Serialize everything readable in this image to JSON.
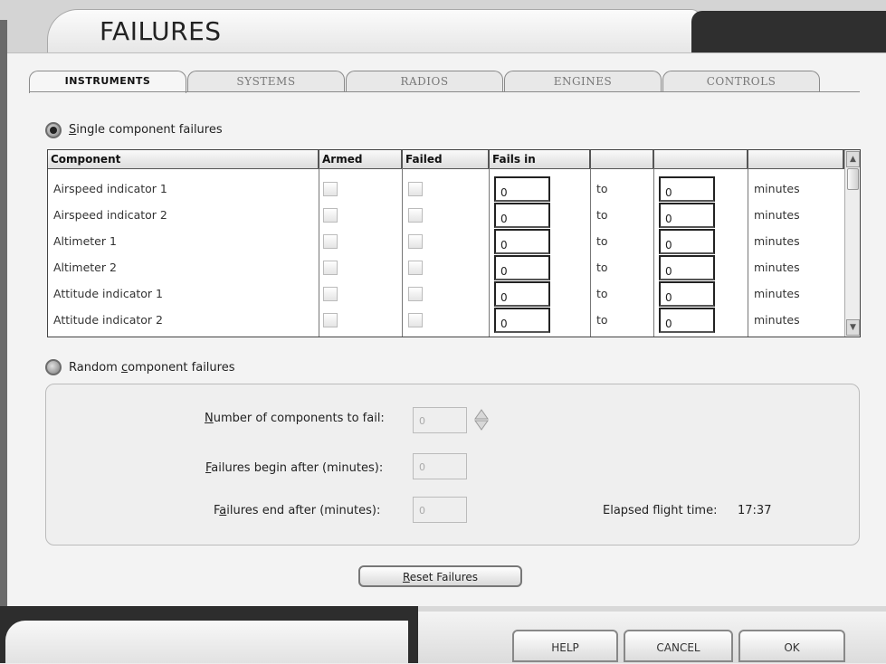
{
  "window": {
    "title": "FAILURES"
  },
  "tabs": [
    {
      "label": "INSTRUMENTS",
      "active": true
    },
    {
      "label": "SYSTEMS",
      "active": false
    },
    {
      "label": "RADIOS",
      "active": false
    },
    {
      "label": "ENGINES",
      "active": false
    },
    {
      "label": "CONTROLS",
      "active": false
    }
  ],
  "single": {
    "label_hot": "S",
    "label_rest": "ingle component failures",
    "selected": true
  },
  "table": {
    "headers": [
      "Component",
      "Armed",
      "Failed",
      "Fails in",
      "",
      "",
      ""
    ],
    "rows": [
      {
        "component": "Airspeed indicator 1",
        "from": "0",
        "to_label": "to",
        "to": "0",
        "unit": "minutes"
      },
      {
        "component": "Airspeed indicator 2",
        "from": "0",
        "to_label": "to",
        "to": "0",
        "unit": "minutes"
      },
      {
        "component": "Altimeter 1",
        "from": "0",
        "to_label": "to",
        "to": "0",
        "unit": "minutes"
      },
      {
        "component": "Altimeter 2",
        "from": "0",
        "to_label": "to",
        "to": "0",
        "unit": "minutes"
      },
      {
        "component": "Attitude indicator 1",
        "from": "0",
        "to_label": "to",
        "to": "0",
        "unit": "minutes"
      },
      {
        "component": "Attitude indicator 2",
        "from": "0",
        "to_label": "to",
        "to": "0",
        "unit": "minutes"
      }
    ]
  },
  "random": {
    "label_pre": "Random ",
    "label_hot": "c",
    "label_rest": "omponent failures",
    "selected": false,
    "num_components": {
      "hot": "N",
      "rest": "umber of components to fail:",
      "value": "0"
    },
    "begin_after": {
      "hot": "F",
      "rest": "ailures begin after (minutes):",
      "value": "0"
    },
    "end_after": {
      "pre": "F",
      "hot": "a",
      "rest": "ilures end after (minutes):",
      "value": "0"
    },
    "elapsed_label": "Elapsed flight time:",
    "elapsed_value": "17:37"
  },
  "reset": {
    "hot": "R",
    "rest": "eset Failures"
  },
  "footer": {
    "help": "HELP",
    "cancel": "CANCEL",
    "ok": "OK"
  }
}
